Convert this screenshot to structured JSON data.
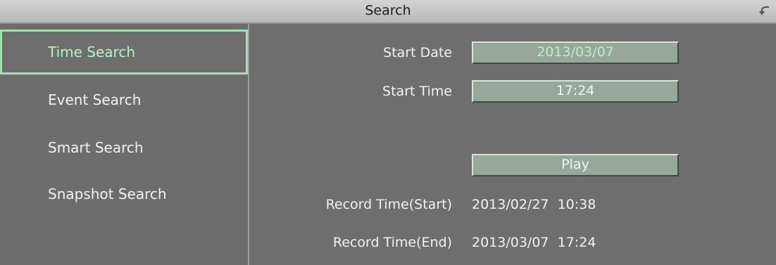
{
  "window": {
    "title": "Search",
    "back_icon": "return-icon"
  },
  "sidebar": {
    "items": [
      {
        "label": "Time Search",
        "active": true
      },
      {
        "label": "Event Search",
        "active": false
      },
      {
        "label": "Smart Search",
        "active": false
      },
      {
        "label": "Snapshot Search",
        "active": false
      }
    ]
  },
  "form": {
    "start_date_label": "Start Date",
    "start_date_value": "2013/03/07",
    "start_time_label": "Start Time",
    "start_time_value": "17:24",
    "play_label": "Play",
    "record_start_label": "Record Time(Start)",
    "record_start_value": "2013/02/27  10:38",
    "record_end_label": "Record Time(End)",
    "record_end_value": "2013/03/07  17:24"
  },
  "colors": {
    "accent": "#b8f0c8",
    "field": "#97a79c",
    "background": "#6e6e6e"
  }
}
